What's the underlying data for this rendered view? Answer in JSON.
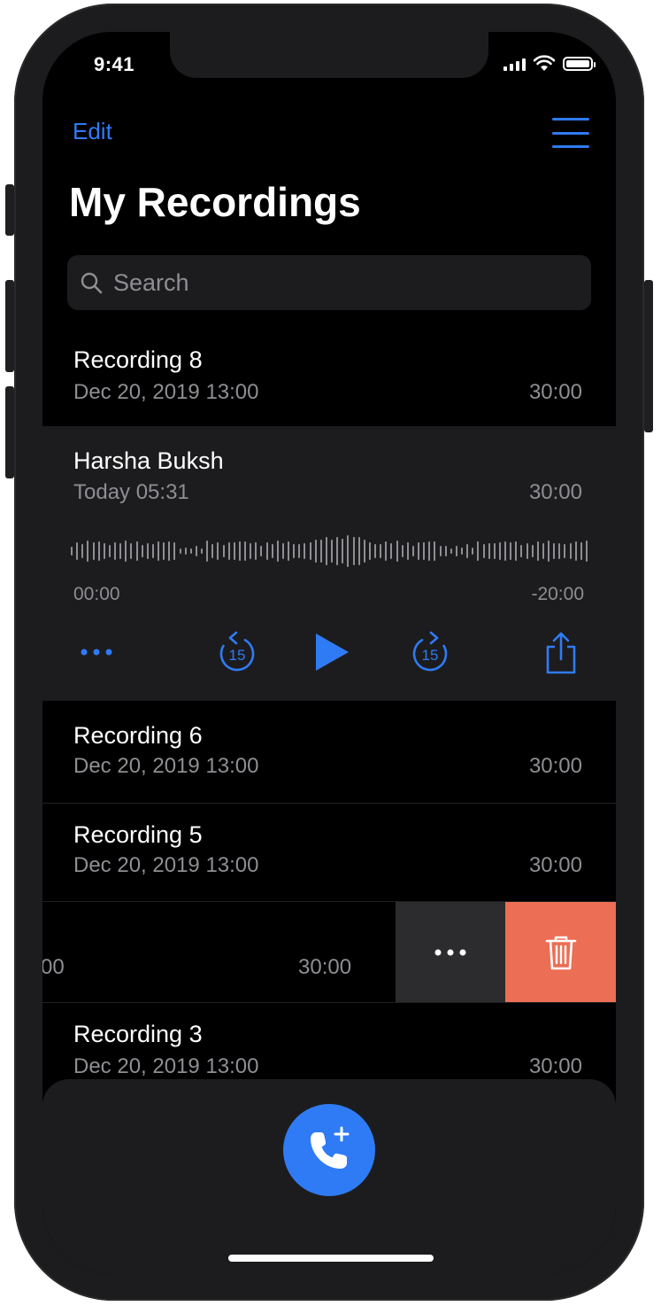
{
  "status": {
    "time": "9:41"
  },
  "header": {
    "edit_label": "Edit",
    "title": "My Recordings",
    "menu_icon": "hamburger-menu-icon"
  },
  "search": {
    "placeholder": "Search"
  },
  "recordings": [
    {
      "name": "Recording 8",
      "date": "Dec 20, 2019 13:00",
      "duration": "30:00"
    },
    {
      "name": "Harsha Buksh",
      "date": "Today 05:31",
      "duration": "30:00",
      "expanded": true,
      "time_start": "00:00",
      "time_end": "-20:00"
    },
    {
      "name": "Recording 6",
      "date": "Dec 20, 2019 13:00",
      "duration": "30:00"
    },
    {
      "name": "Recording 5",
      "date": "Dec 20, 2019 13:00",
      "duration": "30:00"
    },
    {
      "partial_date": "00",
      "duration": "30:00",
      "swiped": true
    },
    {
      "name": "Recording 3",
      "date": "Dec 20, 2019 13:00",
      "duration": "30:00"
    }
  ],
  "controls": {
    "more_icon": "more-dots-icon",
    "rewind_icon": "skip-back-15-icon",
    "rewind_label": "15",
    "play_icon": "play-icon",
    "forward_icon": "skip-forward-15-icon",
    "forward_label": "15",
    "share_icon": "share-icon"
  },
  "swipe_actions": {
    "more_icon": "more-dots-icon",
    "delete_icon": "trash-icon",
    "delete_color": "#ec6e55"
  },
  "fab": {
    "icon": "add-call-icon",
    "color": "#2f7bf5"
  },
  "colors": {
    "accent": "#2f7bf5",
    "background": "#000000",
    "card": "#1c1c1e",
    "secondary_text": "#8e8e93"
  }
}
